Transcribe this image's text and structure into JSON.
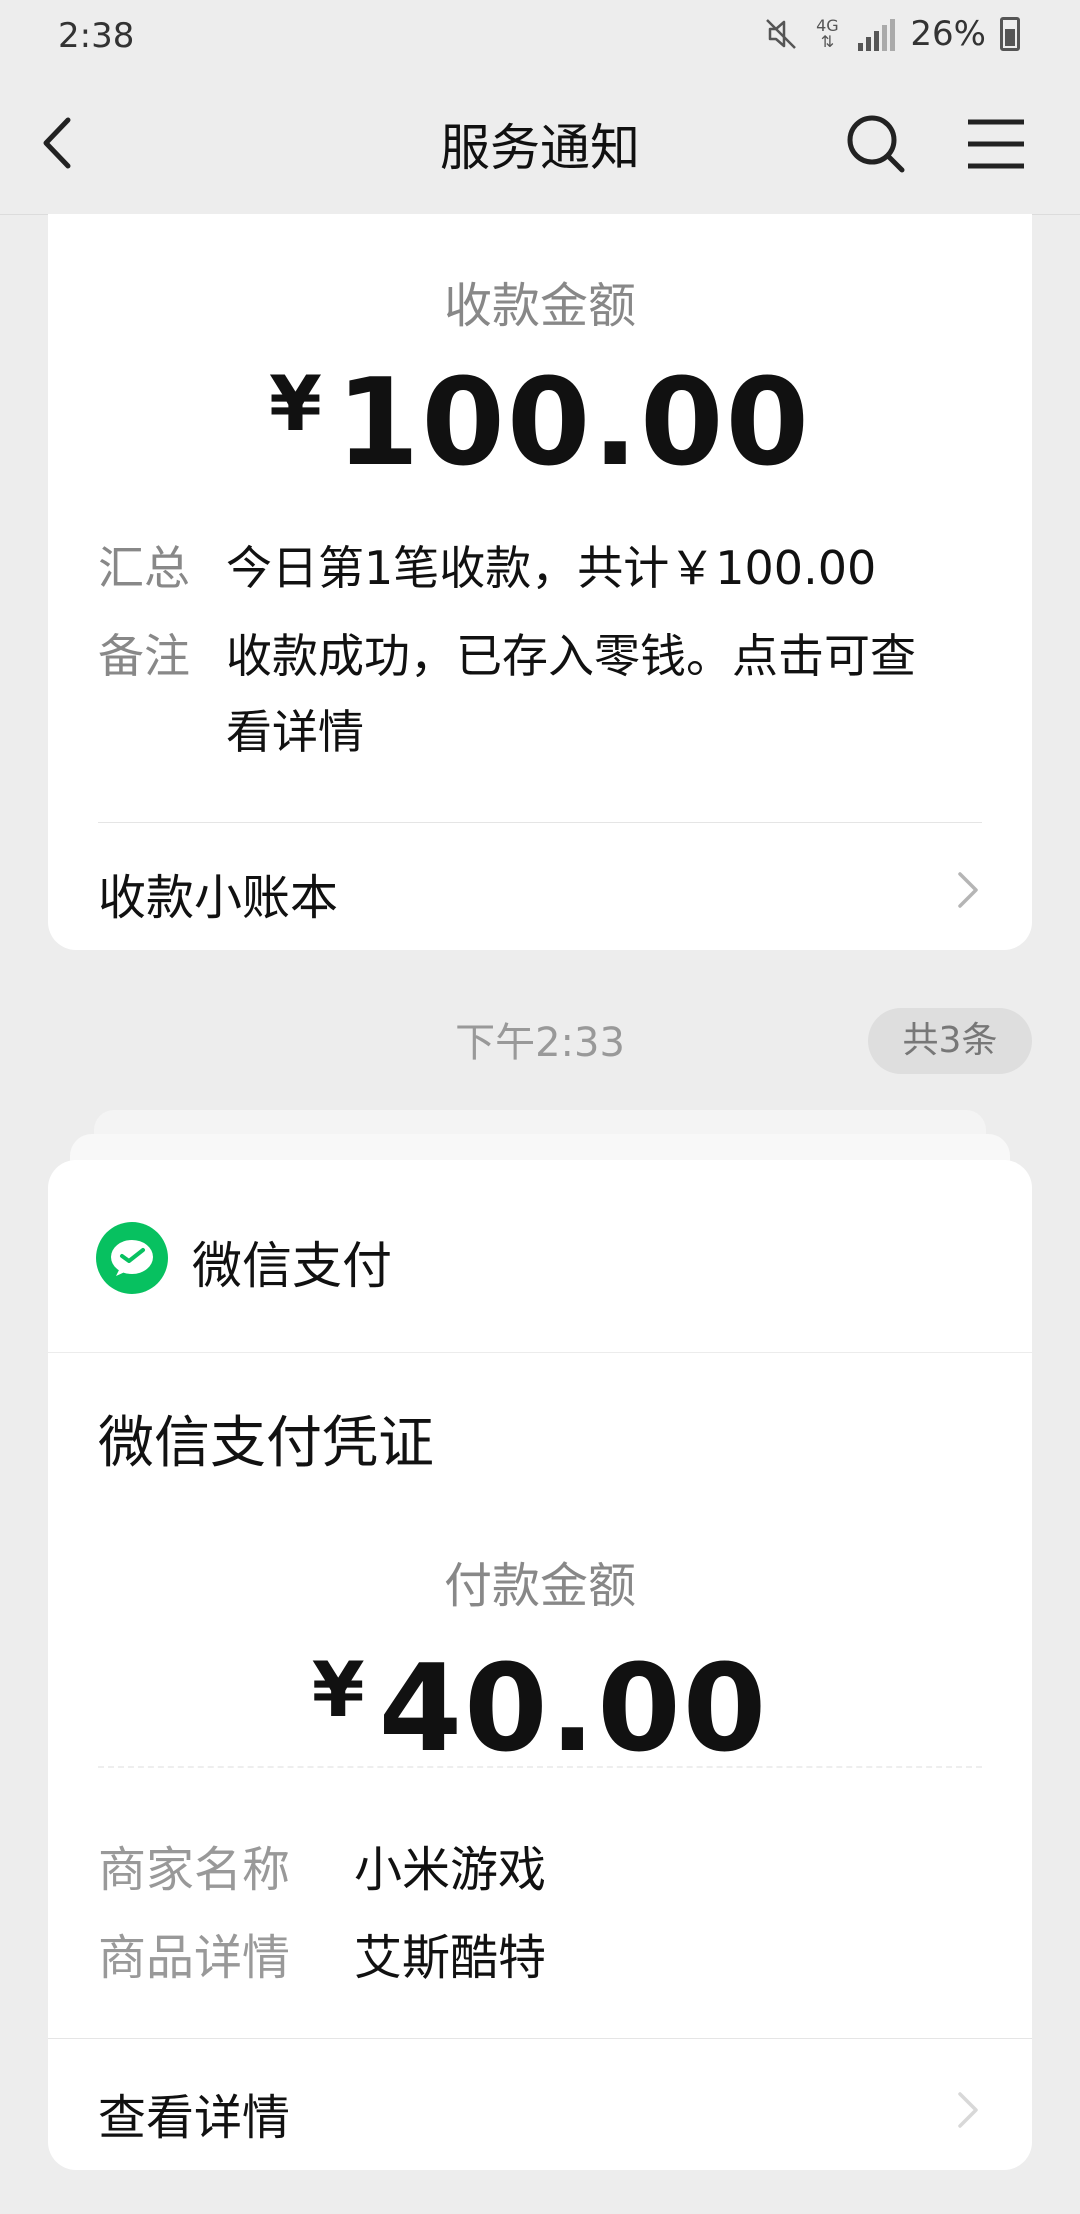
{
  "status_bar": {
    "time": "2:38",
    "network": "4G",
    "battery": "26%"
  },
  "nav": {
    "title": "服务通知"
  },
  "receipt_card": {
    "amount_label": "收款金额",
    "currency": "¥",
    "amount": "100.00",
    "summary_key": "汇总",
    "summary_value": "今日第1笔收款，共计￥100.00",
    "note_key": "备注",
    "note_value_line1": "收款成功，已存入零钱。点击可查",
    "note_value_line2": "看详情",
    "ledger_link": "收款小账本"
  },
  "timestamp": "下午2:33",
  "count_badge": "共3条",
  "payment_card": {
    "brand": "微信支付",
    "title": "微信支付凭证",
    "amount_label": "付款金额",
    "currency": "¥",
    "amount": "40.00",
    "merchant_key": "商家名称",
    "merchant_value": "小米游戏",
    "product_key": "商品详情",
    "product_value": "艾斯酷特",
    "details_link": "查看详情"
  },
  "colors": {
    "background": "#ededed",
    "card": "#ffffff",
    "wechat_green": "#07c160",
    "muted_text": "#888888"
  }
}
